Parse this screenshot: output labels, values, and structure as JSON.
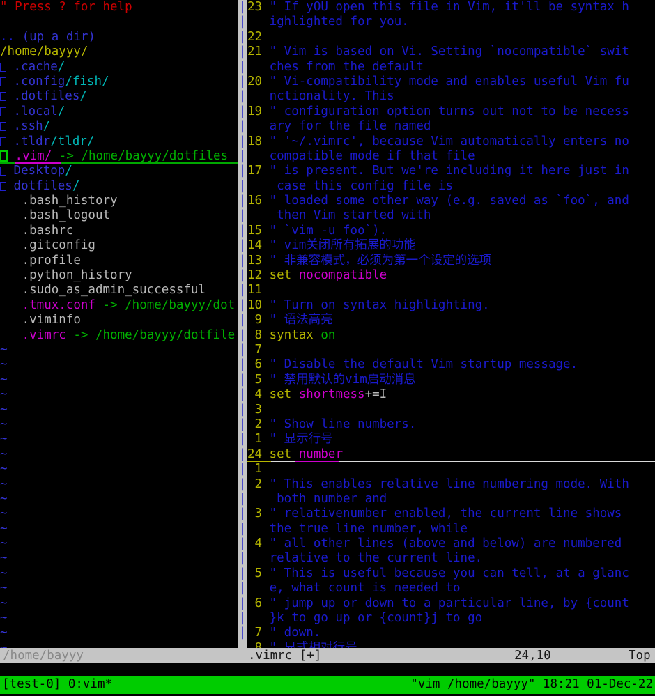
{
  "terminal": {
    "colors": {
      "background": "#000000",
      "red": "#cc0000",
      "blue": "#1a1acc",
      "yellow": "#b5b500",
      "green": "#00b000",
      "magenta": "#cc00cc",
      "grey": "#b8b8b8",
      "statusline_bg": "#c5c5c5",
      "tmux_bg": "#00cc00"
    }
  },
  "explorer": {
    "help_line": "\" Press ? for help",
    "blank_line": "",
    "up_dir": {
      "dots": "..",
      "label": " (up a dir)"
    },
    "cwd": "/home/bayyy/",
    "entries": [
      {
        "icon": "folder-box-icon",
        "name": ".cache",
        "slash": "/",
        "type": "dir"
      },
      {
        "icon": "folder-box-icon",
        "name": ".config",
        "slash": "/",
        "extra": "fish/",
        "type": "dir"
      },
      {
        "icon": "folder-box-icon",
        "name": ".dotfiles",
        "slash": "/",
        "type": "dir"
      },
      {
        "icon": "folder-box-icon",
        "name": ".local",
        "slash": "/",
        "type": "dir"
      },
      {
        "icon": "folder-box-icon",
        "name": ".ssh",
        "slash": "/",
        "type": "dir"
      },
      {
        "icon": "folder-box-icon",
        "name": ".tldr",
        "slash": "/",
        "extra": "tldr/",
        "type": "dir"
      },
      {
        "icon": "cursor-box-icon",
        "name": ".vim",
        "slash": "/",
        "arrow": " -> ",
        "target": "/home/bayyy/dotfiles",
        "type": "dirlink",
        "selected": true
      },
      {
        "icon": "folder-box-icon",
        "name": "Desktop",
        "slash": "/",
        "type": "dir"
      },
      {
        "icon": "folder-box-icon",
        "name": "dotfiles",
        "slash": "/",
        "type": "dir"
      },
      {
        "name": ".bash_history",
        "type": "file"
      },
      {
        "name": ".bash_logout",
        "type": "file"
      },
      {
        "name": ".bashrc",
        "type": "file"
      },
      {
        "name": ".gitconfig",
        "type": "file"
      },
      {
        "name": ".profile",
        "type": "file"
      },
      {
        "name": ".python_history",
        "type": "file"
      },
      {
        "name": ".sudo_as_admin_successful",
        "type": "file"
      },
      {
        "name": ".tmux.conf",
        "arrow": " -> ",
        "target": "/home/bayyy/dot",
        "type": "link"
      },
      {
        "name": ".viminfo",
        "type": "file"
      },
      {
        "name": ".vimrc",
        "arrow": " -> ",
        "target": "/home/bayyy/dotfile",
        "type": "link"
      }
    ],
    "filler_char": "~",
    "filler_count": 21
  },
  "separator": {
    "glyph": "|",
    "rows": 43
  },
  "editor": {
    "lines": [
      {
        "num": "23",
        "text": "\" If yOU open this file in Vim, it'll be syntax h",
        "kind": "comment"
      },
      {
        "num": "",
        "text": "ighlighted for you.",
        "kind": "comment-wrap"
      },
      {
        "num": "22",
        "text": "",
        "kind": "empty"
      },
      {
        "num": "21",
        "text": "\" Vim is based on Vi. Setting `nocompatible` swit",
        "kind": "comment"
      },
      {
        "num": "",
        "text": "ches from the default",
        "kind": "comment-wrap"
      },
      {
        "num": "20",
        "text": "\" Vi-compatibility mode and enables useful Vim fu",
        "kind": "comment"
      },
      {
        "num": "",
        "text": "nctionality. This",
        "kind": "comment-wrap"
      },
      {
        "num": "19",
        "text": "\" configuration option turns out not to be necess",
        "kind": "comment"
      },
      {
        "num": "",
        "text": "ary for the file named",
        "kind": "comment-wrap"
      },
      {
        "num": "18",
        "text": "\" '~/.vimrc', because Vim automatically enters no",
        "kind": "comment"
      },
      {
        "num": "",
        "text": "compatible mode if that file",
        "kind": "comment-wrap"
      },
      {
        "num": "17",
        "text": "\" is present. But we're including it here just in",
        "kind": "comment"
      },
      {
        "num": "",
        "text": " case this config file is",
        "kind": "comment-wrap"
      },
      {
        "num": "16",
        "text": "\" loaded some other way (e.g. saved as `foo`, and",
        "kind": "comment"
      },
      {
        "num": "",
        "text": " then Vim started with",
        "kind": "comment-wrap"
      },
      {
        "num": "15",
        "text": "\" `vim -u foo`).",
        "kind": "comment"
      },
      {
        "num": "14",
        "text": "\" vim关闭所有拓展的功能",
        "kind": "comment"
      },
      {
        "num": "13",
        "text": "\" 非兼容模式，必须为第一个设定的选项",
        "kind": "comment"
      },
      {
        "num": "12",
        "keyword": "set",
        "option": "nocompatible",
        "kind": "setting"
      },
      {
        "num": "11",
        "text": "",
        "kind": "empty"
      },
      {
        "num": "10",
        "text": "\" Turn on syntax highlighting.",
        "kind": "comment"
      },
      {
        "num": "9",
        "text": "\" 语法高亮",
        "kind": "comment"
      },
      {
        "num": "8",
        "keyword": "syntax",
        "value": "on",
        "kind": "syntax"
      },
      {
        "num": "7",
        "text": "",
        "kind": "empty"
      },
      {
        "num": "6",
        "text": "\" Disable the default Vim startup message.",
        "kind": "comment"
      },
      {
        "num": "5",
        "text": "\" 禁用默认的vim启动消息",
        "kind": "comment"
      },
      {
        "num": "4",
        "keyword": "set",
        "option": "shortmess",
        "suffix": "+=I",
        "kind": "setting"
      },
      {
        "num": "3",
        "text": "",
        "kind": "empty"
      },
      {
        "num": "2",
        "text": "\" Show line numbers.",
        "kind": "comment"
      },
      {
        "num": "1",
        "text": "\" 显示行号",
        "kind": "comment"
      },
      {
        "num": "24",
        "keyword": "set",
        "option": "number",
        "kind": "cursorline"
      },
      {
        "num": "1",
        "text": "",
        "kind": "empty"
      },
      {
        "num": "2",
        "text": "\" This enables relative line numbering mode. With",
        "kind": "comment"
      },
      {
        "num": "",
        "text": " both number and",
        "kind": "comment-wrap"
      },
      {
        "num": "3",
        "text": "\" relativenumber enabled, the current line shows",
        "kind": "comment"
      },
      {
        "num": "",
        "text": "the true line number, while",
        "kind": "comment-wrap"
      },
      {
        "num": "4",
        "text": "\" all other lines (above and below) are numbered",
        "kind": "comment"
      },
      {
        "num": "",
        "text": "relative to the current line.",
        "kind": "comment-wrap"
      },
      {
        "num": "5",
        "text": "\" This is useful because you can tell, at a glanc",
        "kind": "comment"
      },
      {
        "num": "",
        "text": "e, what count is needed to",
        "kind": "comment-wrap"
      },
      {
        "num": "6",
        "text": "\" jump up or down to a particular line, by {count",
        "kind": "comment"
      },
      {
        "num": "",
        "text": "}k to go up or {count}j to go",
        "kind": "comment-wrap"
      },
      {
        "num": "7",
        "text": "\" down.",
        "kind": "comment"
      },
      {
        "num": "8",
        "text": "\" 显式相对行号",
        "kind": "comment"
      }
    ]
  },
  "statusline": {
    "left_window": "/home/bayyy",
    "filename": ".vimrc [+]",
    "position": "24,10",
    "scroll": "Top"
  },
  "tmux": {
    "session": "[test-0]",
    "window": "0:vim*",
    "right": "\"vim /home/bayyy\" 18:21 01-Dec-22"
  }
}
